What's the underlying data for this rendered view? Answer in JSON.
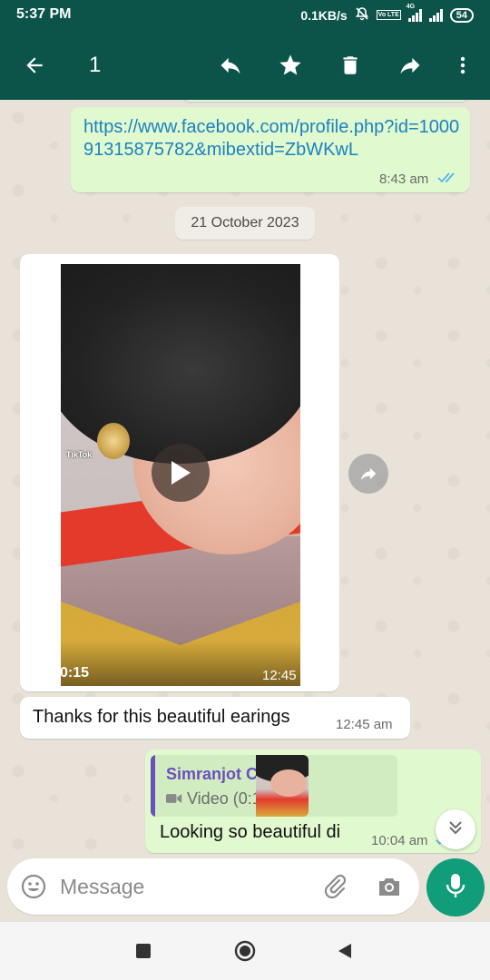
{
  "status_bar": {
    "time": "5:37 PM",
    "network_speed": "0.1KB/s",
    "battery": "54",
    "network_type": "4G",
    "volte": "Vo LTE",
    "icons": [
      "mute-bell-icon",
      "volte-icon",
      "signal-icon",
      "signal-icon",
      "battery-icon"
    ]
  },
  "app_bar": {
    "selected_count": "1",
    "icons": [
      "back-arrow-icon",
      "reply-icon",
      "star-icon",
      "delete-icon",
      "forward-icon",
      "more-vert-icon"
    ],
    "background": "#0c5449"
  },
  "messages": {
    "link_message": {
      "text": "https://www.facebook.com/profile.php?id=100091315875782&mibextid=ZbWKwL",
      "time": "8:43 am",
      "status_icon": "double-check-read-icon"
    },
    "date_chip": "21 October 2023",
    "video_message": {
      "duration": "0:15",
      "time": "12:45 am",
      "watermark": "TikTok",
      "icons": [
        "play-icon",
        "video-camera-icon",
        "forward-icon"
      ]
    },
    "text_message": {
      "text": "Thanks for this beautiful earings",
      "time": "12:45 am"
    },
    "reply_message": {
      "quoted_name": "Simranjot Canada",
      "quoted_type": "Video (0:15)",
      "text": "Looking so beautiful di",
      "time": "10:04 am",
      "status_icon": "double-check-read-icon"
    }
  },
  "composer": {
    "placeholder": "Message",
    "icons": [
      "emoji-icon",
      "attach-icon",
      "camera-icon",
      "mic-icon"
    ]
  },
  "nav_bar": {
    "icons": [
      "recents-square-icon",
      "home-circle-icon",
      "back-triangle-icon"
    ]
  },
  "colors": {
    "header": "#0c5449",
    "outgoing_bubble": "#e1f9cf",
    "incoming_bubble": "#ffffff",
    "link": "#1b82bf",
    "read_ticks": "#4fb6ec",
    "accent": "#0f9d7a",
    "quote_name": "#6b4fbb"
  }
}
